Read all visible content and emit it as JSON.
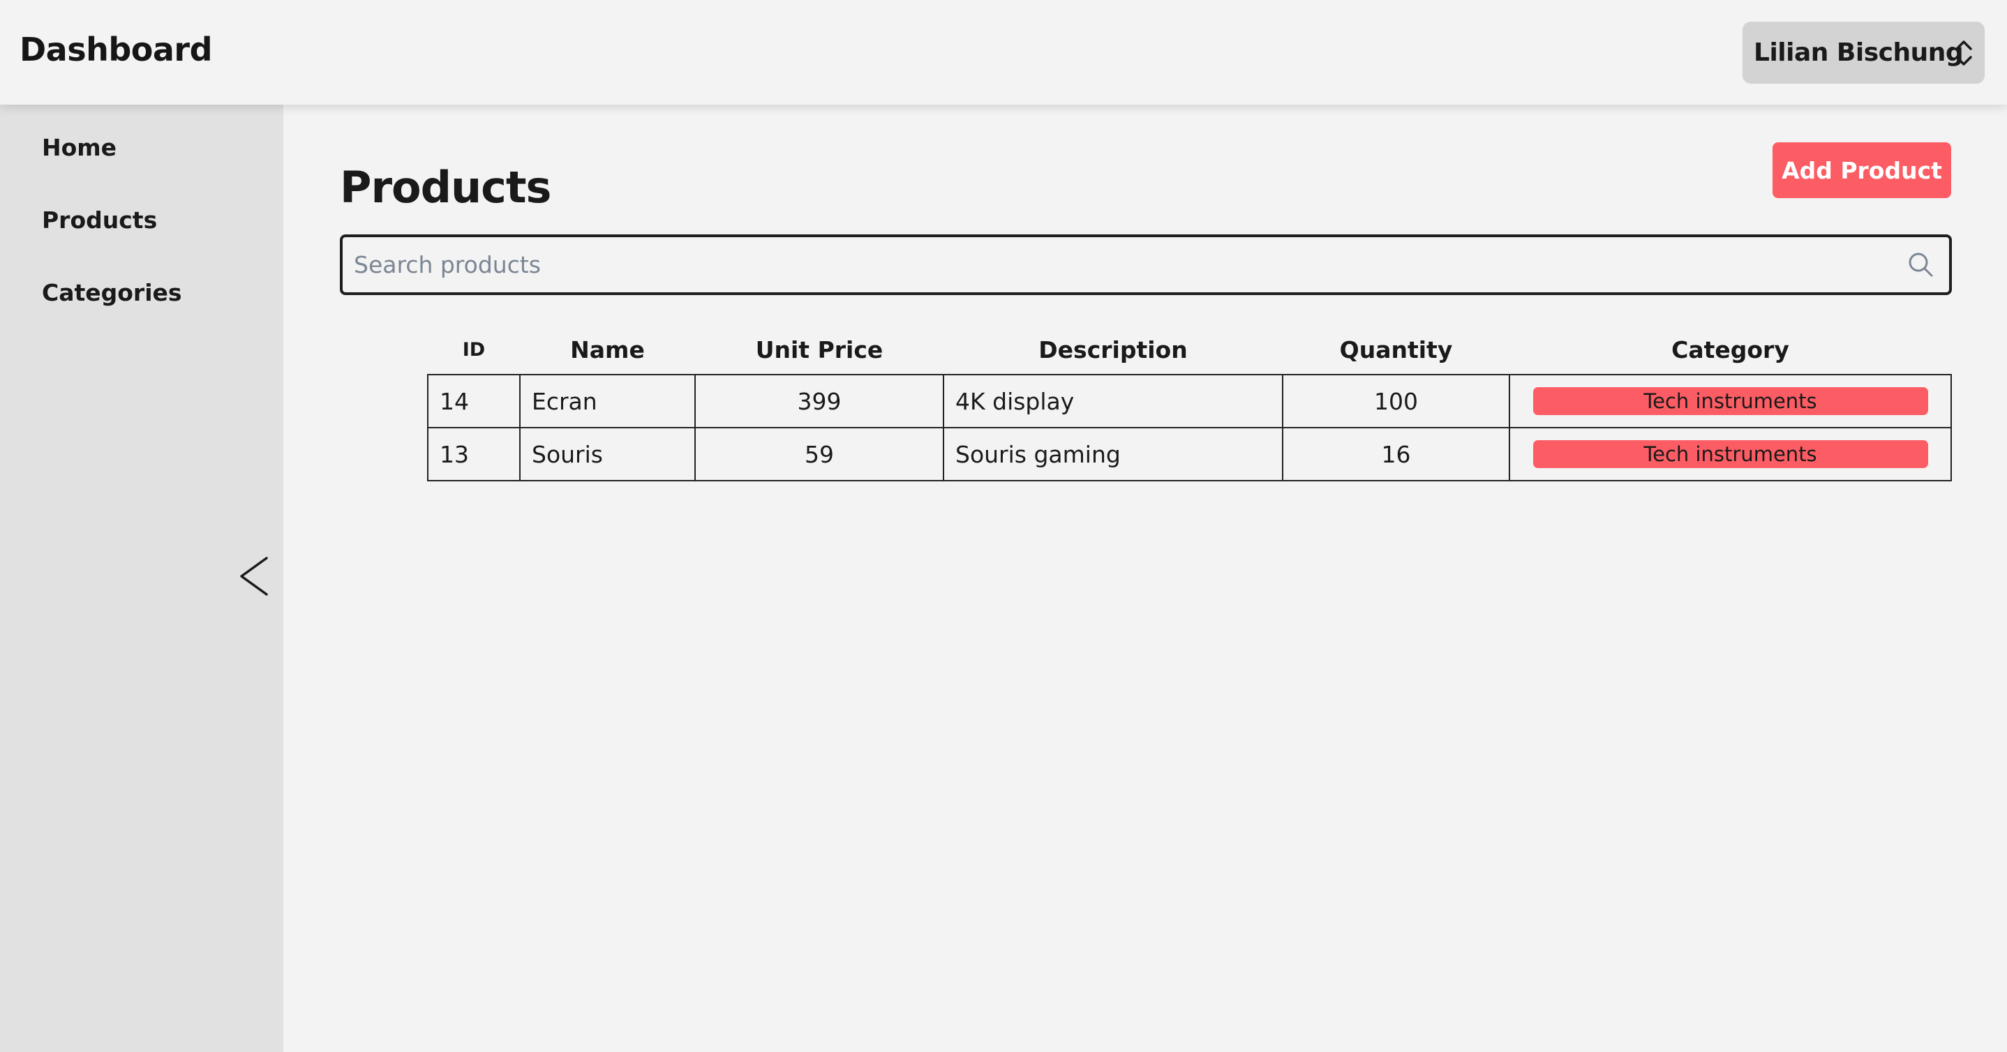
{
  "header": {
    "title": "Dashboard",
    "user_name": "Lilian Bischung"
  },
  "sidebar": {
    "items": [
      {
        "label": "Home"
      },
      {
        "label": "Products"
      },
      {
        "label": "Categories"
      }
    ],
    "collapse_icon": "chevron-left-icon"
  },
  "main": {
    "title": "Products",
    "add_button_label": "Add Product",
    "search": {
      "placeholder": "Search products",
      "value": "",
      "icon": "search-icon"
    },
    "table": {
      "columns": [
        "ID",
        "Name",
        "Unit Price",
        "Description",
        "Quantity",
        "Category"
      ],
      "rows": [
        {
          "id": "14",
          "name": "Ecran",
          "unit_price": "399",
          "description": "4K display",
          "quantity": "100",
          "category": "Tech instruments"
        },
        {
          "id": "13",
          "name": "Souris",
          "unit_price": "59",
          "description": "Souris gaming",
          "quantity": "16",
          "category": "Tech instruments"
        }
      ]
    }
  },
  "colors": {
    "accent": "#fc5c63",
    "page_background": "#f3f3f3",
    "sidebar_background": "#e1e1e1",
    "user_menu_background": "#d3d3d3"
  }
}
